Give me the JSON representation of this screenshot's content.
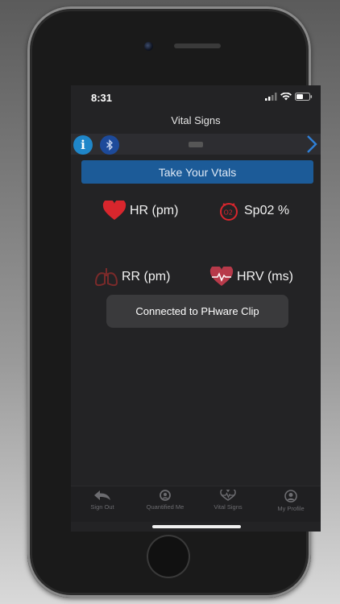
{
  "status_bar": {
    "time": "8:31"
  },
  "nav": {
    "title": "Vital Signs"
  },
  "toolbar": {
    "info_icon": "info-icon",
    "bluetooth_icon": "bluetooth-icon",
    "next_icon": "chevron-right-icon"
  },
  "actions": {
    "take_vitals_label": "Take Your Vtals"
  },
  "vitals": [
    {
      "label": "HR (pm)",
      "icon": "heart-icon",
      "color": "#d8262d"
    },
    {
      "label": "Sp02 %",
      "icon": "oxygen-icon",
      "color": "#d8262d"
    },
    {
      "label": "RR (pm)",
      "icon": "lungs-icon",
      "color": "#7a2a2a"
    },
    {
      "label": "HRV (ms)",
      "icon": "heart-pulse-icon",
      "color": "#b73a4a"
    }
  ],
  "toast": {
    "message": "Connected to PHware Clip"
  },
  "tabbar": {
    "items": [
      {
        "label": "Sign Out",
        "icon": "sign-out-icon"
      },
      {
        "label": "Quantified Me",
        "icon": "quantified-me-icon"
      },
      {
        "label": "Vital Signs",
        "icon": "vital-signs-icon"
      },
      {
        "label": "My Profile",
        "icon": "profile-icon"
      }
    ]
  },
  "colors": {
    "accent": "#1c5b98",
    "screen_bg": "#232325",
    "info": "#1f86c9"
  }
}
